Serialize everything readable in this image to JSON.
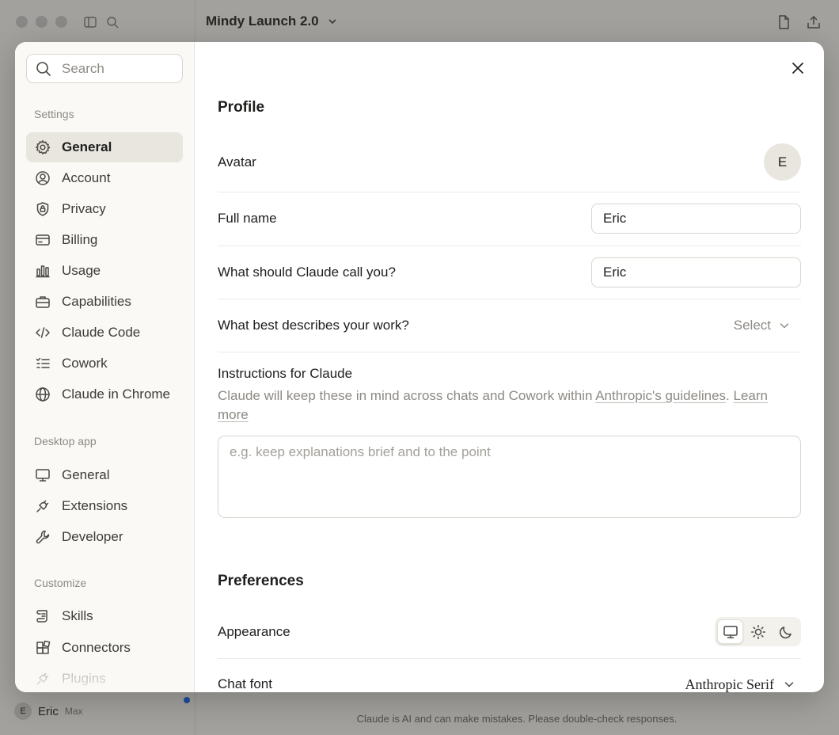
{
  "background": {
    "project_title": "Mindy Launch 2.0",
    "user_initial": "E",
    "user_name": "Eric",
    "user_plan": "Max",
    "disclaimer": "Claude is AI and can make mistakes. Please double-check responses."
  },
  "sidebar": {
    "search_placeholder": "Search",
    "sections": {
      "settings": "Settings",
      "desktop": "Desktop app",
      "customize": "Customize"
    },
    "settings_items": [
      {
        "label": "General",
        "icon": "gear-icon"
      },
      {
        "label": "Account",
        "icon": "user-circle-icon"
      },
      {
        "label": "Privacy",
        "icon": "shield-lock-icon"
      },
      {
        "label": "Billing",
        "icon": "credit-card-icon"
      },
      {
        "label": "Usage",
        "icon": "bar-chart-icon"
      },
      {
        "label": "Capabilities",
        "icon": "toolbox-icon"
      },
      {
        "label": "Claude Code",
        "icon": "code-icon"
      },
      {
        "label": "Cowork",
        "icon": "checklist-icon"
      },
      {
        "label": "Claude in Chrome",
        "icon": "globe-icon"
      }
    ],
    "desktop_items": [
      {
        "label": "General",
        "icon": "monitor-icon"
      },
      {
        "label": "Extensions",
        "icon": "plug-icon"
      },
      {
        "label": "Developer",
        "icon": "wrench-icon"
      }
    ],
    "customize_items": [
      {
        "label": "Skills",
        "icon": "scroll-icon"
      },
      {
        "label": "Connectors",
        "icon": "blocks-icon"
      },
      {
        "label": "Plugins",
        "icon": "plug-icon"
      }
    ]
  },
  "profile": {
    "heading": "Profile",
    "avatar_label": "Avatar",
    "avatar_initial": "E",
    "full_name_label": "Full name",
    "full_name_value": "Eric",
    "call_you_label": "What should Claude call you?",
    "call_you_value": "Eric",
    "work_label": "What best describes your work?",
    "work_select": "Select",
    "instructions_title": "Instructions for Claude",
    "instructions_desc_prefix": "Claude will keep these in mind across chats and Cowork within ",
    "instructions_link_guidelines": "Anthropic's guidelines",
    "instructions_desc_mid": ". ",
    "instructions_link_learn": "Learn more",
    "instructions_placeholder": "e.g. keep explanations brief and to the point"
  },
  "preferences": {
    "heading": "Preferences",
    "appearance_label": "Appearance",
    "appearance_options": [
      "monitor-icon",
      "sun-icon",
      "moon-icon"
    ],
    "appearance_selected": "system",
    "chat_font_label": "Chat font",
    "chat_font_value": "Anthropic Serif"
  },
  "colors": {
    "active_nav_bg": "#e8e6df",
    "sidebar_bg": "#faf9f5",
    "notification_dot": "#2c78e8"
  }
}
